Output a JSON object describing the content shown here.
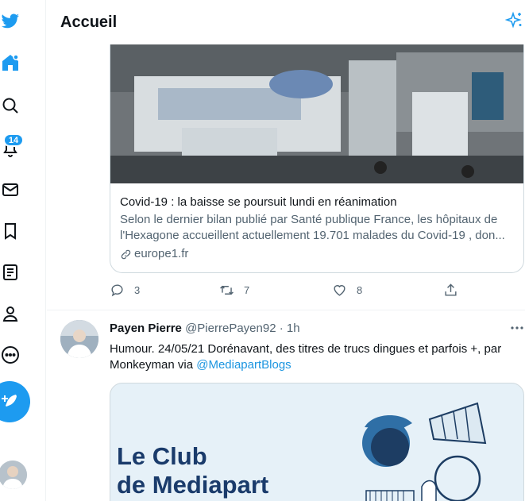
{
  "header": {
    "title": "Accueil",
    "sparkle_icon": "sparkle-icon"
  },
  "nav": {
    "notifications_badge": "14",
    "items": [
      "twitter-bird-icon",
      "home-icon",
      "explore-icon",
      "notifications-icon",
      "messages-icon",
      "bookmarks-icon",
      "lists-icon",
      "profile-icon",
      "more-icon"
    ],
    "accent": "#1d9bf0"
  },
  "prev_tweet": {
    "card": {
      "title": "Covid-19 : la baisse se poursuit lundi en réanimation",
      "description": "Selon le dernier bilan publié par Santé publique France, les hôpitaux de l'Hexagone accueillent actuellement 19.701 malades du Covid-19 , don...",
      "domain": "europe1.fr"
    },
    "actions": {
      "replies": "3",
      "retweets": "7",
      "likes": "8"
    }
  },
  "tweet": {
    "author_name": "Payen Pierre",
    "meta": "@PierrePayen92 · 1h",
    "text": "Humour. 24/05/21 Dorénavant, des titres de trucs dingues et parfois +, par Monkeyman via ",
    "mention": "@MediapartBlogs",
    "media_title_line1": "Le Club",
    "media_title_line2": "de Mediapart"
  }
}
